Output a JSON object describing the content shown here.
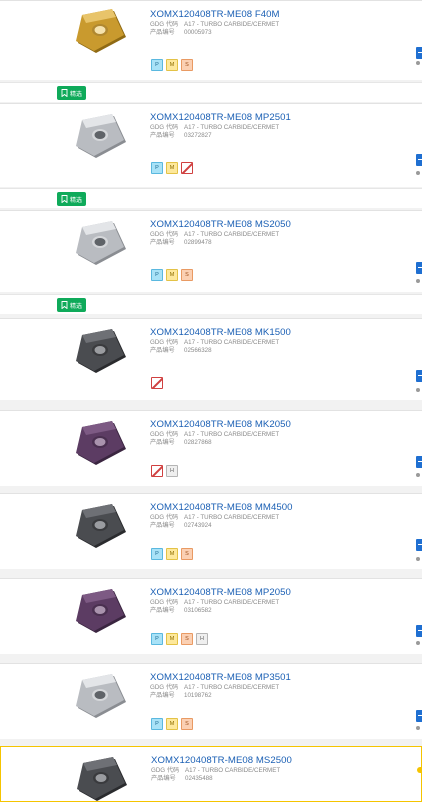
{
  "filter_label": "精选",
  "field_labels": {
    "gdg": "GDG 代码",
    "product_no": "产品编号"
  },
  "products": [
    {
      "title": "XOMX120408TR-ME08 F40M",
      "gdg": "A17 - TURBO CARBIDE/CERMET",
      "number": "00005973",
      "badges": [
        "P",
        "M",
        "S"
      ],
      "insert_color": "gold"
    },
    {
      "title": "XOMX120408TR-ME08 MP2501",
      "gdg": "A17 - TURBO CARBIDE/CERMET",
      "number": "03272827",
      "badges": [
        "P",
        "M",
        "X"
      ],
      "insert_color": "silver"
    },
    {
      "title": "XOMX120408TR-ME08 MS2050",
      "gdg": "A17 - TURBO CARBIDE/CERMET",
      "number": "02899478",
      "badges": [
        "P",
        "M",
        "S"
      ],
      "insert_color": "silver"
    },
    {
      "title": "XOMX120408TR-ME08 MK1500",
      "gdg": "A17 - TURBO CARBIDE/CERMET",
      "number": "02566328",
      "badges": [
        "X"
      ],
      "insert_color": "dark"
    },
    {
      "title": "XOMX120408TR-ME08 MK2050",
      "gdg": "A17 - TURBO CARBIDE/CERMET",
      "number": "02827868",
      "badges": [
        "X",
        "H"
      ],
      "insert_color": "purple"
    },
    {
      "title": "XOMX120408TR-ME08 MM4500",
      "gdg": "A17 - TURBO CARBIDE/CERMET",
      "number": "02743924",
      "badges": [
        "P",
        "M",
        "S"
      ],
      "insert_color": "dark"
    },
    {
      "title": "XOMX120408TR-ME08 MP2050",
      "gdg": "A17 - TURBO CARBIDE/CERMET",
      "number": "03106582",
      "badges": [
        "P",
        "M",
        "S",
        "H"
      ],
      "insert_color": "purple"
    },
    {
      "title": "XOMX120408TR-ME08 MP3501",
      "gdg": "A17 - TURBO CARBIDE/CERMET",
      "number": "10198762",
      "badges": [
        "P",
        "M",
        "S"
      ],
      "insert_color": "silver"
    },
    {
      "title": "XOMX120408TR-ME08 MS2500",
      "gdg": "A17 - TURBO CARBIDE/CERMET",
      "number": "02435488",
      "badges": [],
      "insert_color": "dark"
    }
  ],
  "badge_letters": {
    "P": "P",
    "M": "M",
    "S": "S",
    "H": "H",
    "X": ""
  },
  "colors": {
    "title_blue": "#1a5fb4",
    "filter_green": "#0faa5a",
    "highlight_yellow": "#f5c400",
    "action_blue": "#1f6fd1"
  }
}
